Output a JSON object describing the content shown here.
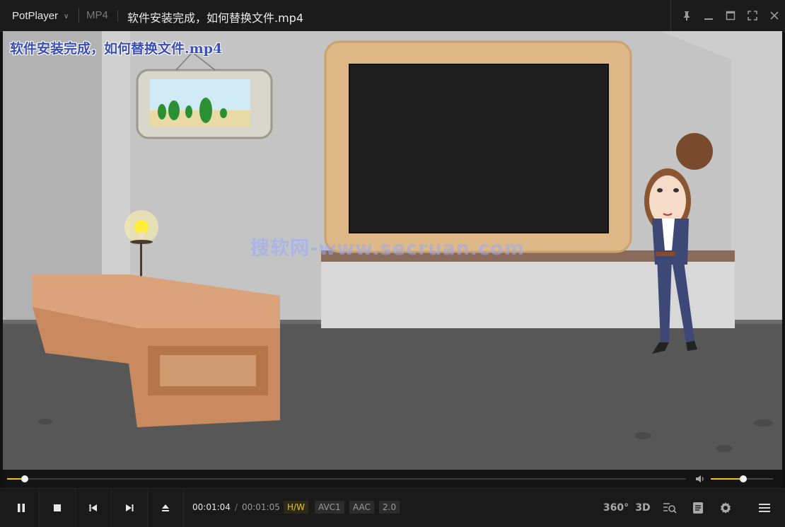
{
  "titlebar": {
    "app_name": "PotPlayer",
    "format": "MP4",
    "file_title": "软件安装完成，如何替换文件.mp4",
    "buttons": [
      "pin-icon",
      "minimize-icon",
      "maximize-icon",
      "fullscreen-icon",
      "close-icon"
    ]
  },
  "video": {
    "osd_title": "软件安装完成，如何替换文件.mp4",
    "watermark": "搜软网-www.secruan.com"
  },
  "seek": {
    "progress": 0.026,
    "volume": 0.52
  },
  "controls": {
    "current_time": "00:01:04",
    "separator": "/",
    "total_time": "00:01:05",
    "badges": {
      "hw": "H/W",
      "video_codec": "AVC1",
      "audio_codec": "AAC",
      "channels": "2.0"
    },
    "right": {
      "vr_label": "360°",
      "three_d_label": "3D"
    }
  },
  "colors": {
    "accent": "#f1c40f",
    "titlebar_bg": "#1b1b1b",
    "controls_bg": "#1a1a1a"
  }
}
